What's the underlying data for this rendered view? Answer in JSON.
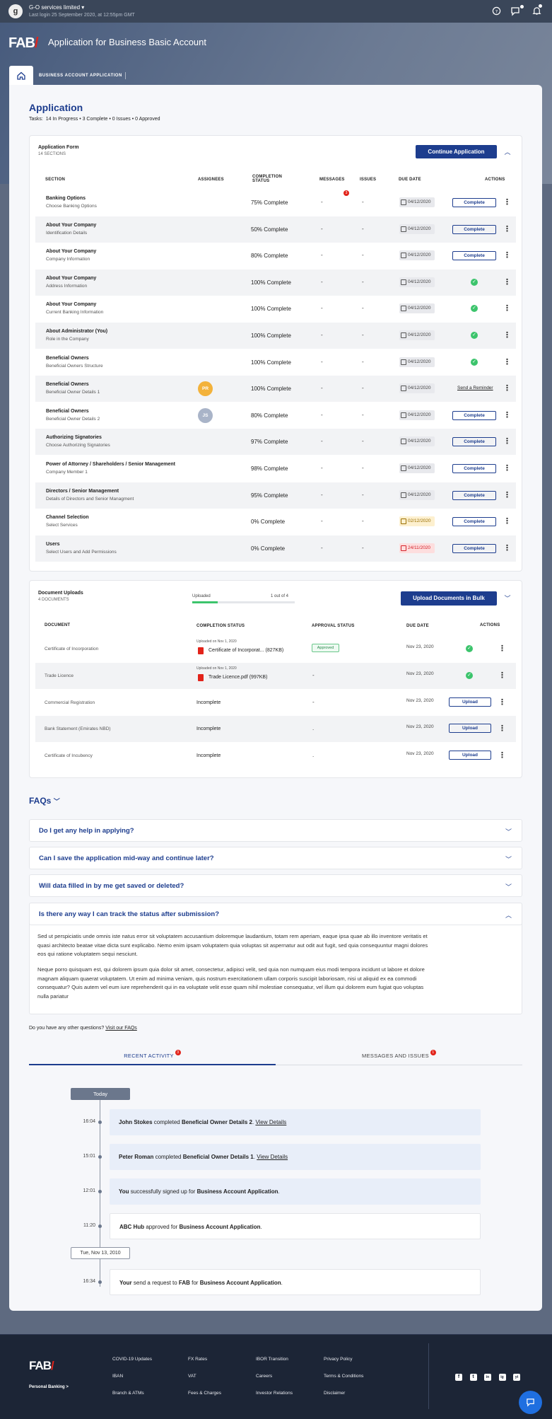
{
  "topbar": {
    "org": "G-O services limited",
    "last_login": "Last login 25 September 2020, at 12:55pm GMT",
    "avatar_letter": "g"
  },
  "header": {
    "title": "Application for Business Basic Account",
    "logo_text": "FAB"
  },
  "tab": {
    "label": "BUSINESS ACCOUNT APPLICATION"
  },
  "application": {
    "title": "Application",
    "tasks_label": "Tasks:",
    "tasks": "14 In Progress  •  3 Complete  •  0 Issues  •  0 Approved"
  },
  "app_form": {
    "title": "Application Form",
    "subtitle": "14 SECTIONS",
    "continue_label": "Continue Application",
    "headers": {
      "section": "SECTION",
      "assignees": "ASSIGNEES",
      "status": "COMPLETION STATUS",
      "messages": "MESSAGES",
      "issues": "ISSUES",
      "due": "DUE DATE",
      "actions": "ACTIONS"
    },
    "message_badge": "3",
    "rows": [
      {
        "title": "Banking Options",
        "sub": "Choose Banking Options",
        "assignee": "",
        "status": "75% Complete",
        "messages": "-",
        "issues": "-",
        "due": "04/12/2020",
        "due_style": "",
        "action": "Complete"
      },
      {
        "title": "About Your Company",
        "sub": "Identification Details",
        "assignee": "",
        "status": "50% Complete",
        "messages": "-",
        "issues": "-",
        "due": "04/12/2020",
        "due_style": "",
        "action": "Complete"
      },
      {
        "title": "About Your Company",
        "sub": "Company Information",
        "assignee": "",
        "status": "80% Complete",
        "messages": "-",
        "issues": "-",
        "due": "04/12/2020",
        "due_style": "",
        "action": "Complete"
      },
      {
        "title": "About Your Company",
        "sub": "Address Information",
        "assignee": "",
        "status": "100% Complete",
        "messages": "-",
        "issues": "-",
        "due": "04/12/2020",
        "due_style": "",
        "action": "check"
      },
      {
        "title": "About Your Company",
        "sub": "Current Banking Information",
        "assignee": "",
        "status": "100% Complete",
        "messages": "-",
        "issues": "-",
        "due": "04/12/2020",
        "due_style": "",
        "action": "check"
      },
      {
        "title": "About Administrator (You)",
        "sub": "Role in the Company",
        "assignee": "",
        "status": "100% Complete",
        "messages": "-",
        "issues": "-",
        "due": "04/12/2020",
        "due_style": "",
        "action": "check"
      },
      {
        "title": "Beneficial Owners",
        "sub": "Beneficial Owners Structure",
        "assignee": "",
        "status": "100% Complete",
        "messages": "-",
        "issues": "-",
        "due": "04/12/2020",
        "due_style": "",
        "action": "check"
      },
      {
        "title": "Beneficial Owners",
        "sub": "Beneficial Owner Details 1",
        "assignee": "PR",
        "assignee_color": "#f3b23b",
        "status": "100% Complete",
        "messages": "-",
        "issues": "-",
        "due": "04/12/2020",
        "due_style": "",
        "action": "Send a Reminder"
      },
      {
        "title": "Beneficial Owners",
        "sub": "Beneficial Owner Details 2",
        "assignee": "JS",
        "assignee_color": "#a9b4c8",
        "status": "80% Complete",
        "messages": "-",
        "issues": "-",
        "due": "04/12/2020",
        "due_style": "",
        "action": "Complete"
      },
      {
        "title": "Authorizing Signatories",
        "sub": "Choose Authorizing Signatories",
        "assignee": "",
        "status": "97% Complete",
        "messages": "-",
        "issues": "-",
        "due": "04/12/2020",
        "due_style": "",
        "action": "Complete"
      },
      {
        "title": "Power of Attorney / Shareholders / Senior Management",
        "sub": "Company Member 1",
        "assignee": "",
        "status": "98% Complete",
        "messages": "-",
        "issues": "-",
        "due": "04/12/2020",
        "due_style": "",
        "action": "Complete"
      },
      {
        "title": "Directors / Senior Management",
        "sub": "Details of Directors and Senior Managment",
        "assignee": "",
        "status": "95% Complete",
        "messages": "-",
        "issues": "-",
        "due": "04/12/2020",
        "due_style": "",
        "action": "Complete"
      },
      {
        "title": "Channel Selection",
        "sub": "Select Services",
        "assignee": "",
        "status": "0% Complete",
        "messages": "-",
        "issues": "-",
        "due": "02/12/2020",
        "due_style": "yel",
        "action": "Complete"
      },
      {
        "title": "Users",
        "sub": "Select Users and Add Permissions",
        "assignee": "",
        "status": "0% Complete",
        "messages": "-",
        "issues": "-",
        "due": "24/11/2020",
        "due_style": "red",
        "action": "Complete"
      }
    ]
  },
  "uploads": {
    "title": "Document Uploads",
    "subtitle": "4 DOCUMENTS",
    "progress_label": "Uploaded",
    "progress_count": "1 out of 4",
    "progress_fraction": 0.25,
    "bulk_label": "Upload Documents in Bulk",
    "headers": {
      "document": "DOCUMENT",
      "status": "COMPLETION STATUS",
      "approval": "APPROVAL STATUS",
      "due": "DUE DATE",
      "actions": "ACTIONS"
    },
    "rows": [
      {
        "name": "Certificate of Incorporation",
        "uploaded": "Uploaded on Nov 1, 2020",
        "file": "Certificate of Incorporat... (827KB)",
        "status": "",
        "approval": "Approved",
        "due": "Nov 23, 2020",
        "action": "check"
      },
      {
        "name": "Trade Licence",
        "uploaded": "Uploaded on Nov 1, 2020",
        "file": "Trade Licence.pdf (997KB)",
        "status": "",
        "approval": "-",
        "due": "Nov 23, 2020",
        "action": "check"
      },
      {
        "name": "Commercial Registration",
        "uploaded": "",
        "file": "",
        "status": "Incomplete",
        "approval": "-",
        "due": "Nov 23, 2020",
        "action": "Upload"
      },
      {
        "name": "Bank Statement (Emirates NBD)",
        "uploaded": "",
        "file": "",
        "status": "Incomplete",
        "approval": ".",
        "due": "Nov 23, 2020",
        "action": "Upload"
      },
      {
        "name": "Certificate of Incubency",
        "uploaded": "",
        "file": "",
        "status": "Incomplete",
        "approval": ".",
        "due": "Nov 23, 2020",
        "action": "Upload"
      }
    ]
  },
  "faqs": {
    "title": "FAQs",
    "items": [
      {
        "q": "Do I get any help in applying?"
      },
      {
        "q": "Can I save the application mid-way and continue later?"
      },
      {
        "q": "Will data filled in by me get saved or deleted?"
      },
      {
        "q": "Is there any way I can track the status after submission?"
      }
    ],
    "answer_p1": "Sed ut perspiciatis unde omnis iste natus error sit voluptatem accusantium doloremque laudantium, totam rem aperiam, eaque ipsa quae ab illo inventore veritatis et quasi architecto beatae vitae dicta sunt explicabo. Nemo enim ipsam voluptatem quia voluptas sit aspernatur aut odit aut fugit, sed quia consequuntur magni dolores eos qui ratione voluptatem sequi nesciunt.",
    "answer_p2": "Neque porro quisquam est, qui dolorem ipsum quia dolor sit amet, consectetur, adipisci velit, sed quia non numquam eius modi tempora incidunt ut labore et dolore magnam aliquam quaerat voluptatem. Ut enim ad minima veniam, quis nostrum exercitationem ullam corporis suscipit laboriosam, nisi ut aliquid ex ea commodi consequatur? Quis autem vel eum iure reprehenderit qui in ea voluptate velit esse quam nihil molestiae consequatur, vel illum qui dolorem eum fugiat quo voluptas nulla pariatur",
    "other_q": "Do you have any other questions?",
    "other_link": "Visit our FAQs"
  },
  "activity": {
    "tab1": "RECENT ACTIVITY",
    "tab1_badge": "3",
    "tab2": "MESSAGES AND ISSUES",
    "tab2_badge": "1",
    "today": "Today",
    "date2": "Tue, Nov 13, 2010",
    "items": [
      {
        "time": "16:04",
        "who": "John Stokes",
        "mid": " completed ",
        "what": "Beneficial Owner Details 2",
        "end": ". ",
        "link": "View Details"
      },
      {
        "time": "15:01",
        "who": "Peter Roman",
        "mid": " completed ",
        "what": "Beneficial Owner Details 1",
        "end": ". ",
        "link": "View Details"
      },
      {
        "time": "12:01",
        "who": "You",
        "mid": " successfully signed up for ",
        "what": "Business Account Application",
        "end": ".",
        "link": ""
      },
      {
        "time": "11:20",
        "who": "ABC Hub",
        "mid": " approved for ",
        "what": "Business Account Application",
        "end": ".",
        "link": ""
      },
      {
        "time": "16:34",
        "who": "Your",
        "mid": " send a request to ",
        "what": "FAB",
        "end": " for ",
        "what2": "Business Account Application",
        "end2": "."
      }
    ]
  },
  "footer": {
    "logo": "FAB",
    "personal": "Personal Banking >",
    "col1": [
      "COVID-19 Updates",
      "IBAN",
      "Branch & ATMs"
    ],
    "col2": [
      "FX Rates",
      "VAT",
      "Fees & Charges"
    ],
    "col3": [
      "IBOR Transition",
      "Careers",
      "Investor Relations"
    ],
    "col4": [
      "Privacy Policy",
      "Terms & Conditions",
      "Disclaimer"
    ],
    "social": [
      "f",
      "t",
      "in",
      "ig",
      "yt"
    ]
  }
}
